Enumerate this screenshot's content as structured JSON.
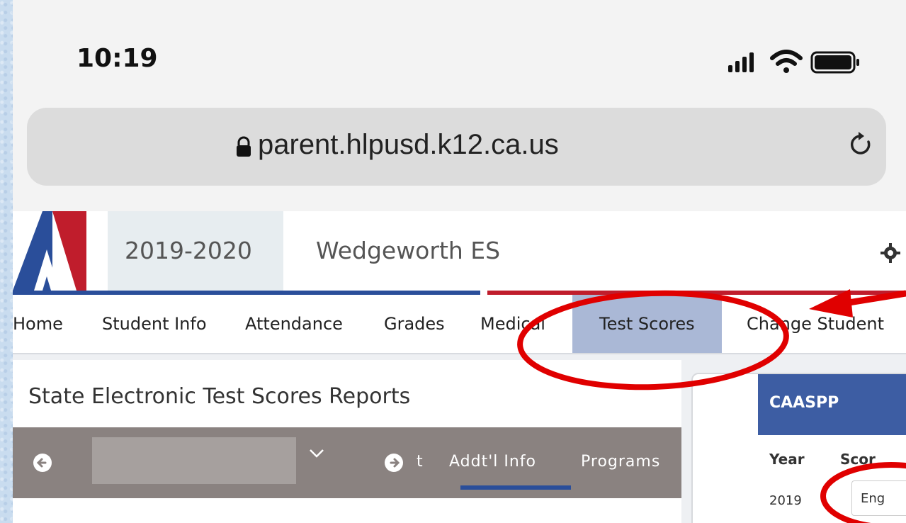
{
  "status_bar": {
    "time": "10:19"
  },
  "browser": {
    "url": "parent.hlpusd.k12.ca.us"
  },
  "app": {
    "year": "2019-2020",
    "school": "Wedgeworth ES",
    "nav": [
      "Home",
      "Student Info",
      "Attendance",
      "Grades",
      "Medical",
      "Test Scores",
      "Change Student"
    ],
    "active_nav": "Test Scores"
  },
  "page": {
    "title": "State Electronic Test Scores Reports",
    "tabs": [
      "t",
      "Addt'l Info",
      "Programs"
    ]
  },
  "card": {
    "title": "CAASPP",
    "columns": [
      "Year",
      "Scor"
    ],
    "row": {
      "year": "2019",
      "selected": "Eng"
    }
  },
  "colors": {
    "brand_blue": "#2a4e9a",
    "brand_red": "#c01d2c",
    "active_tab": "#aab8d6",
    "annotation_red": "#e00000"
  }
}
